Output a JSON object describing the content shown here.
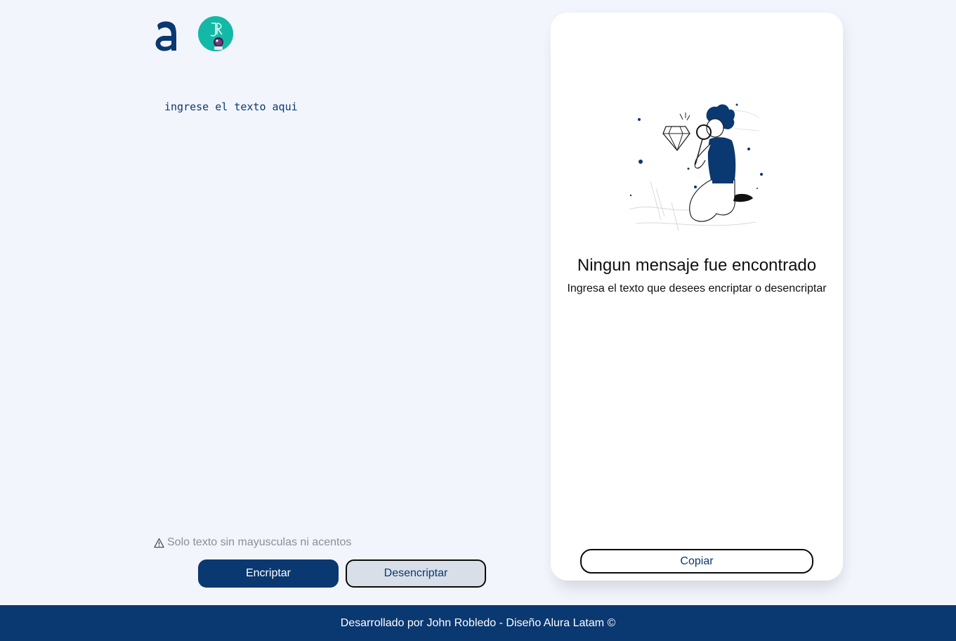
{
  "header": {
    "logo_alura_icon": "alura-logo-icon",
    "logo_jr_icon": "jr-astronaut-avatar-icon"
  },
  "input": {
    "placeholder": "ingrese el texto aqui",
    "value": ""
  },
  "warning": {
    "icon": "warning-triangle-icon",
    "text": "Solo texto sin mayusculas ni acentos"
  },
  "buttons": {
    "encrypt_label": "Encriptar",
    "decrypt_label": "Desencriptar"
  },
  "output": {
    "illustration_icon": "person-with-magnifier-illustration",
    "title": "Ningun mensaje fue encontrado",
    "subtitle": "Ingresa el texto que desees encriptar o desencriptar",
    "copy_label": "Copiar"
  },
  "footer": {
    "text": "Desarrollado por John Robledo - Diseño Alura Latam ©"
  },
  "colors": {
    "background": "#f2f5fc",
    "primary": "#0a3871",
    "secondary_button": "#d8dfe8",
    "panel": "#ffffff",
    "warning_text": "#8a8f98",
    "avatar_teal": "#14b8a6"
  }
}
